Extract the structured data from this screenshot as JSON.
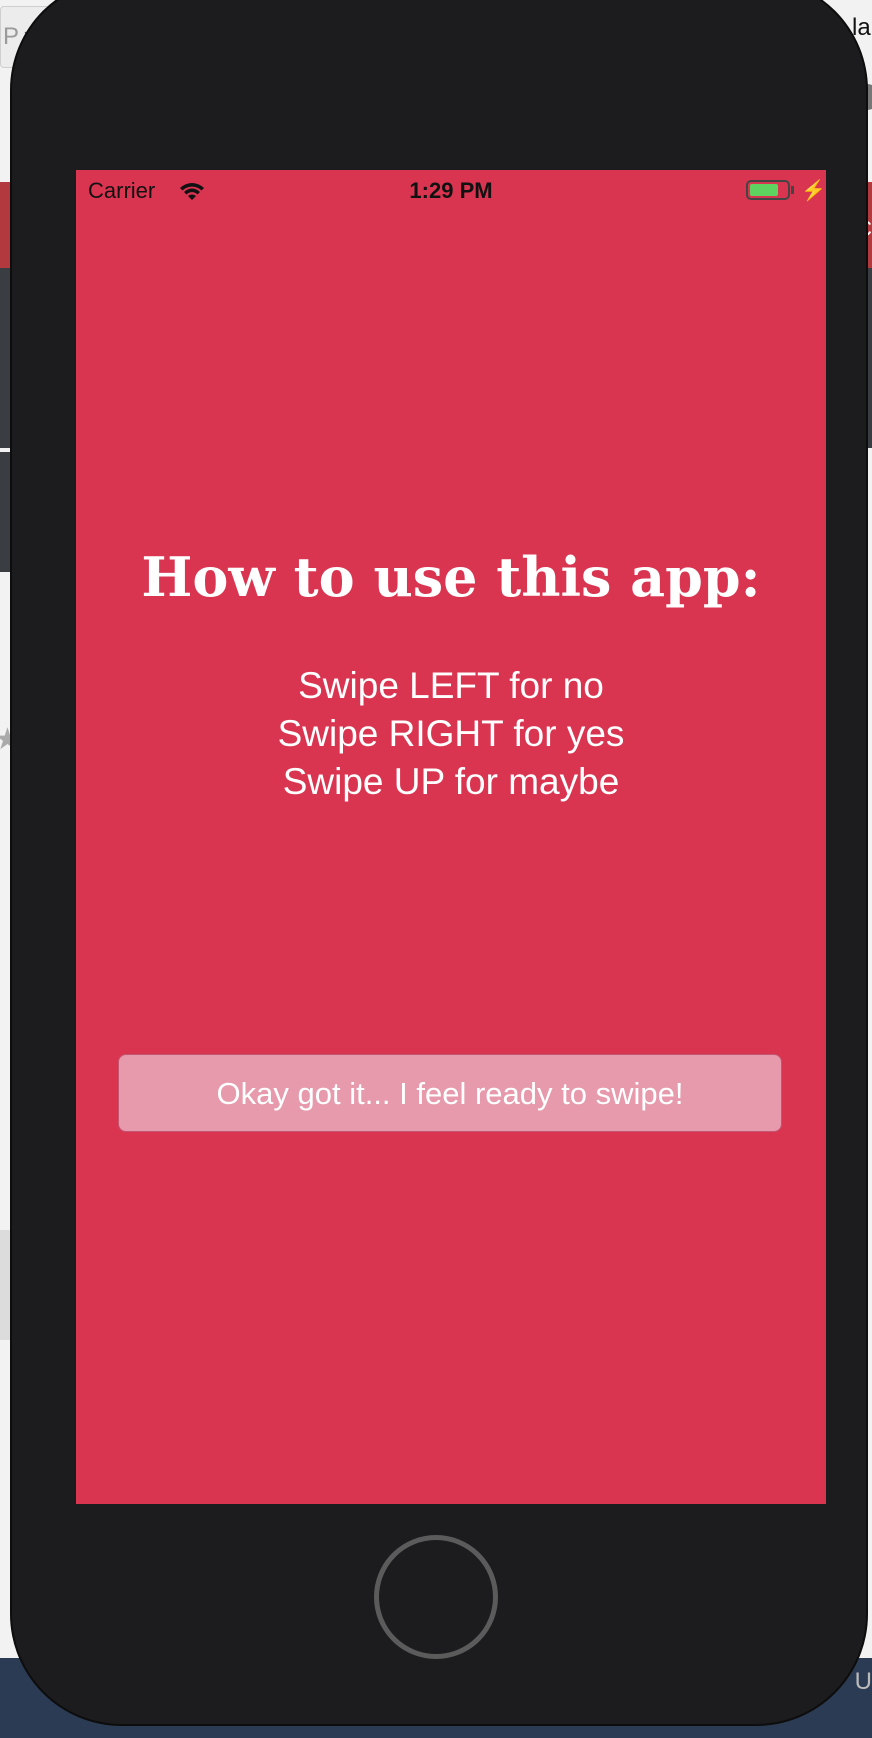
{
  "background": {
    "tab_letter": "P",
    "tab_close": "×",
    "top_right_text": "la",
    "right_letter": "C",
    "bottom_right_letter": "U"
  },
  "status_bar": {
    "carrier": "Carrier",
    "time": "1:29 PM",
    "icons": [
      "wifi-icon",
      "battery-icon",
      "charge-icon"
    ]
  },
  "main": {
    "title": "How to use this app:",
    "instructions": [
      "Swipe LEFT for no",
      "Swipe RIGHT for yes",
      "Swipe UP for maybe"
    ],
    "button_label": "Okay got it... I feel ready to swipe!"
  },
  "colors": {
    "screen_background": "#d93551",
    "button_background": "#e69aac",
    "text": "#ffffff",
    "battery": "#5fd35f"
  }
}
